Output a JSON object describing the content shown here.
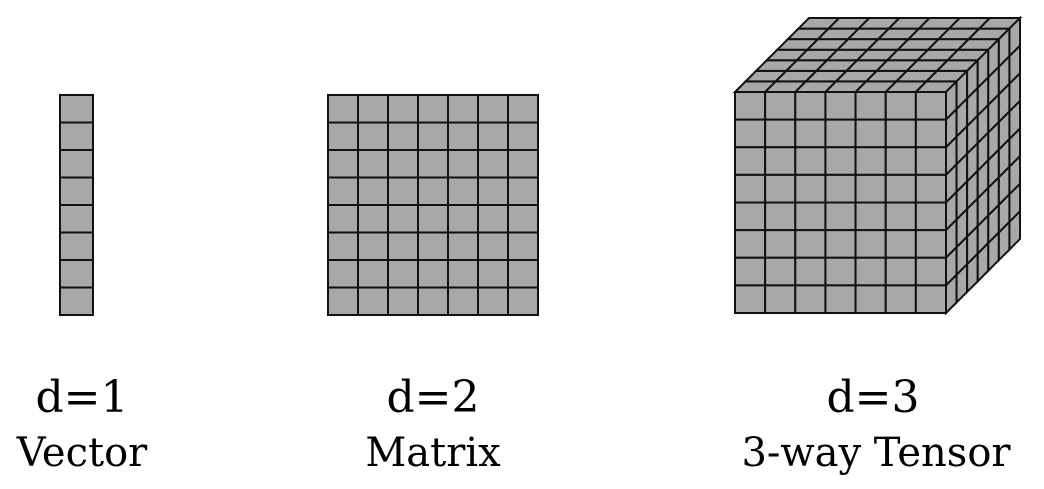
{
  "colors": {
    "fill": "#a8a8a8",
    "stroke": "#111111",
    "background": "#ffffff"
  },
  "items": [
    {
      "dim_label": "d=1",
      "name": "Vector",
      "shape": "column",
      "cells": [
        1,
        8
      ]
    },
    {
      "dim_label": "d=2",
      "name": "Matrix",
      "shape": "grid",
      "cells": [
        7,
        8
      ]
    },
    {
      "dim_label": "d=3",
      "name": "3-way Tensor",
      "shape": "cube",
      "cells": [
        7,
        8,
        7
      ]
    }
  ]
}
